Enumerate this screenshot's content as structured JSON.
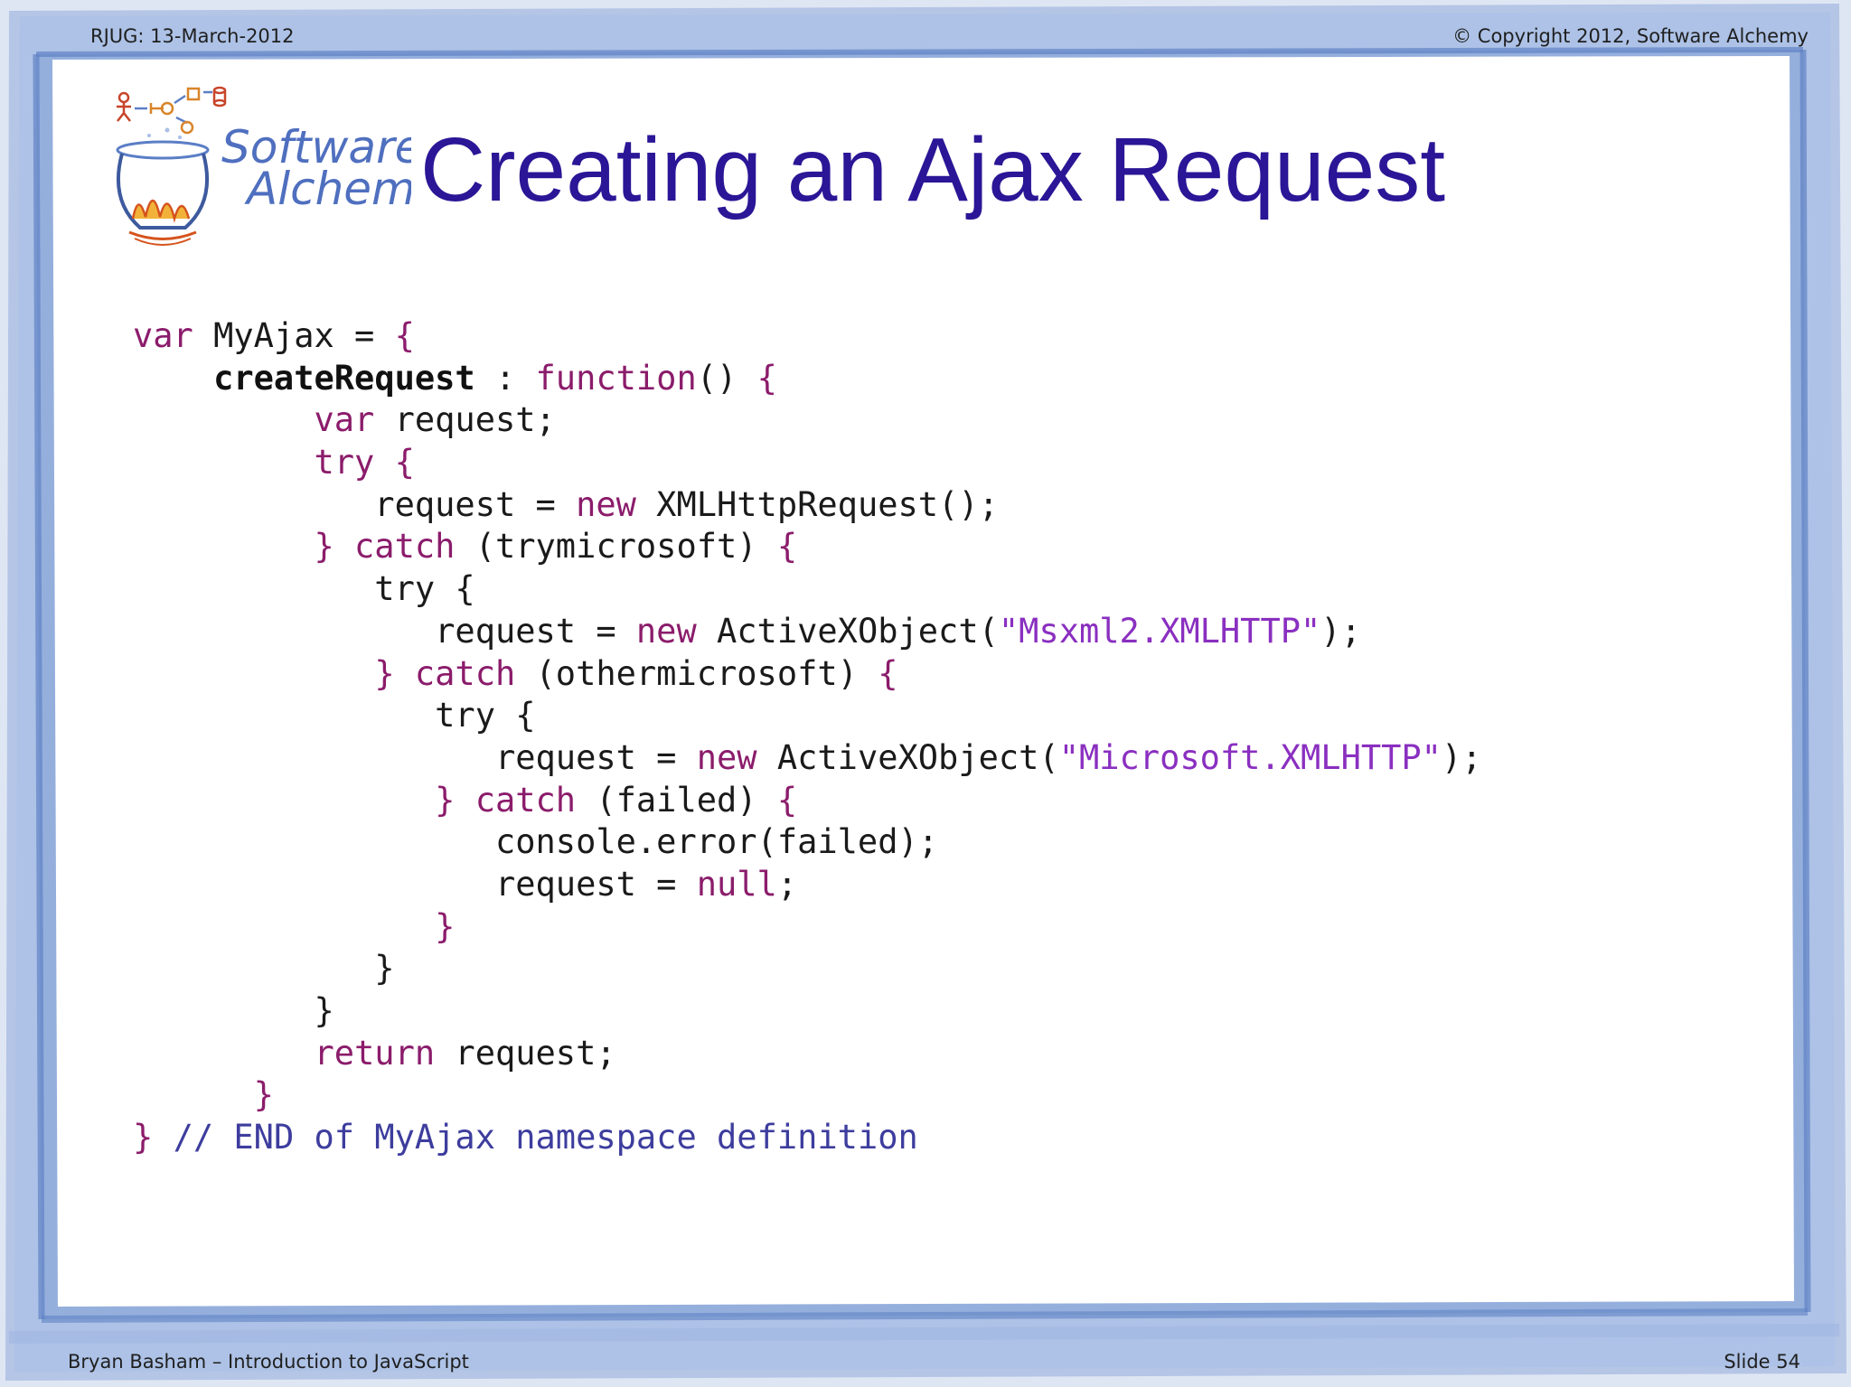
{
  "header": {
    "left": "RJUG:  13-March-2012",
    "right": "© Copyright 2012, Software Alchemy"
  },
  "logo": {
    "line1": "Software",
    "line2": "Alchemy"
  },
  "title": "Creating an Ajax Request",
  "code": {
    "lines": [
      [
        {
          "t": "var",
          "c": "kw"
        },
        {
          "t": " MyAjax = ",
          "c": "plain"
        },
        {
          "t": "{",
          "c": "kw"
        }
      ],
      [
        {
          "t": "    ",
          "c": "plain"
        },
        {
          "t": "createRequest",
          "c": "bold"
        },
        {
          "t": " : ",
          "c": "plain"
        },
        {
          "t": "function",
          "c": "kw"
        },
        {
          "t": "() ",
          "c": "plain"
        },
        {
          "t": "{",
          "c": "kw"
        }
      ],
      [
        {
          "t": "         ",
          "c": "plain"
        },
        {
          "t": "var",
          "c": "kw"
        },
        {
          "t": " request;",
          "c": "plain"
        }
      ],
      [
        {
          "t": "         ",
          "c": "plain"
        },
        {
          "t": "try {",
          "c": "kw"
        }
      ],
      [
        {
          "t": "            request = ",
          "c": "plain"
        },
        {
          "t": "new",
          "c": "kw"
        },
        {
          "t": " XMLHttpRequest();",
          "c": "plain"
        }
      ],
      [
        {
          "t": "         ",
          "c": "plain"
        },
        {
          "t": "} catch",
          "c": "kw"
        },
        {
          "t": " (trymicrosoft) ",
          "c": "plain"
        },
        {
          "t": "{",
          "c": "kw"
        }
      ],
      [
        {
          "t": "            try {",
          "c": "plain"
        }
      ],
      [
        {
          "t": "               request = ",
          "c": "plain"
        },
        {
          "t": "new",
          "c": "kw"
        },
        {
          "t": " ActiveXObject(",
          "c": "plain"
        },
        {
          "t": "\"Msxml2.XMLHTTP\"",
          "c": "str"
        },
        {
          "t": ");",
          "c": "plain"
        }
      ],
      [
        {
          "t": "            ",
          "c": "plain"
        },
        {
          "t": "} catch",
          "c": "kw"
        },
        {
          "t": " (othermicrosoft) ",
          "c": "plain"
        },
        {
          "t": "{",
          "c": "kw"
        }
      ],
      [
        {
          "t": "               try {",
          "c": "plain"
        }
      ],
      [
        {
          "t": "                  request = ",
          "c": "plain"
        },
        {
          "t": "new",
          "c": "kw"
        },
        {
          "t": " ActiveXObject(",
          "c": "plain"
        },
        {
          "t": "\"Microsoft.XMLHTTP\"",
          "c": "str"
        },
        {
          "t": ");",
          "c": "plain"
        }
      ],
      [
        {
          "t": "               ",
          "c": "plain"
        },
        {
          "t": "} catch",
          "c": "kw"
        },
        {
          "t": " (failed) ",
          "c": "plain"
        },
        {
          "t": "{",
          "c": "kw"
        }
      ],
      [
        {
          "t": "                  console.error(failed);",
          "c": "plain"
        }
      ],
      [
        {
          "t": "                  request = ",
          "c": "plain"
        },
        {
          "t": "null",
          "c": "kw"
        },
        {
          "t": ";",
          "c": "plain"
        }
      ],
      [
        {
          "t": "               ",
          "c": "plain"
        },
        {
          "t": "}",
          "c": "kw"
        }
      ],
      [
        {
          "t": "            }",
          "c": "plain"
        }
      ],
      [
        {
          "t": "         }",
          "c": "plain"
        }
      ],
      [
        {
          "t": "         ",
          "c": "plain"
        },
        {
          "t": "return",
          "c": "kw"
        },
        {
          "t": " request;",
          "c": "plain"
        }
      ],
      [
        {
          "t": "      ",
          "c": "plain"
        },
        {
          "t": "}",
          "c": "kw"
        }
      ],
      [
        {
          "t": "} ",
          "c": "kw"
        },
        {
          "t": "// END of MyAjax namespace definition",
          "c": "cm"
        }
      ]
    ]
  },
  "footer": {
    "left": "Bryan Basham – Introduction to JavaScript",
    "right": "Slide 54"
  },
  "colors": {
    "title": "#2a1696",
    "keyword": "#8b1c6b",
    "string": "#8a2fc0",
    "comment": "#3d3d9e",
    "frame": "#7f9fd4"
  }
}
